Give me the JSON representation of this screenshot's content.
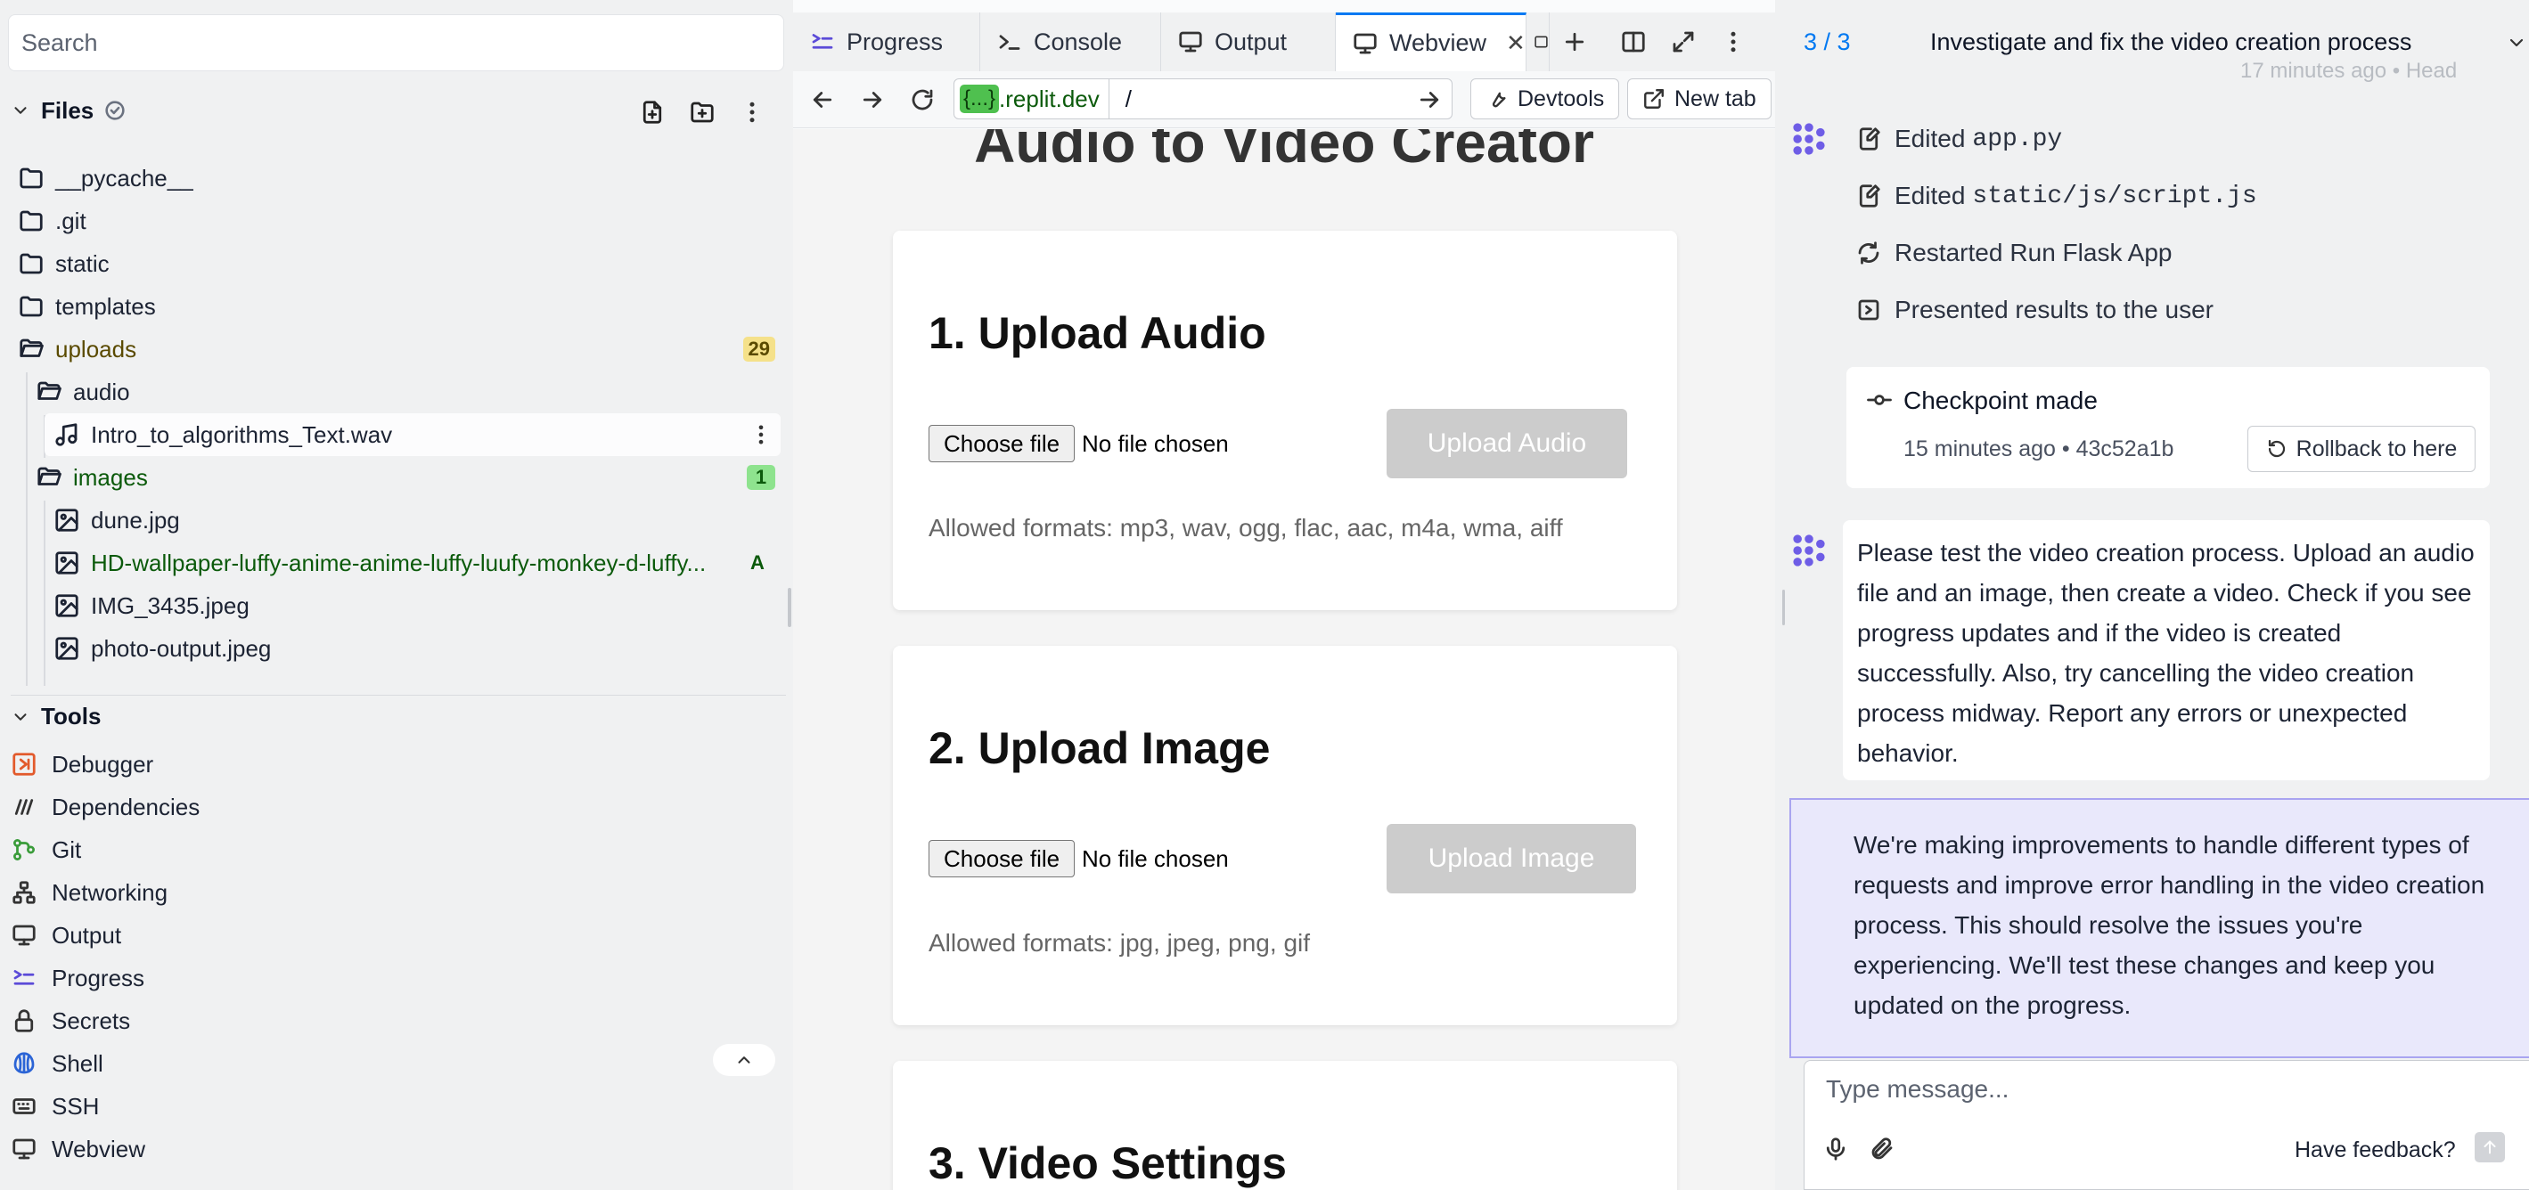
{
  "left": {
    "search_placeholder": "Search",
    "files_label": "Files",
    "tree": [
      {
        "name": "__pycache__",
        "type": "folder"
      },
      {
        "name": ".git",
        "type": "folder"
      },
      {
        "name": "static",
        "type": "folder"
      },
      {
        "name": "templates",
        "type": "folder"
      },
      {
        "name": "uploads",
        "type": "folder",
        "badge": "29"
      },
      {
        "name": "audio",
        "type": "folder"
      },
      {
        "name": "Intro_to_algorithms_Text.wav",
        "type": "audio"
      },
      {
        "name": "images",
        "type": "folder",
        "badge": "1"
      },
      {
        "name": "dune.jpg",
        "type": "image"
      },
      {
        "name": "HD-wallpaper-luffy-anime-anime-luffy-luufy-monkey-d-luffy...",
        "type": "image",
        "badge": "A"
      },
      {
        "name": "IMG_3435.jpeg",
        "type": "image"
      },
      {
        "name": "photo-output.jpeg",
        "type": "image"
      }
    ],
    "tools_label": "Tools",
    "tools": [
      "Debugger",
      "Dependencies",
      "Git",
      "Networking",
      "Output",
      "Progress",
      "Secrets",
      "Shell",
      "SSH",
      "Webview"
    ]
  },
  "middle": {
    "tabs": [
      "Progress",
      "Console",
      "Output",
      "Webview"
    ],
    "url_pill": "{...}",
    "url_domain": ".replit.dev",
    "url_path": "/",
    "devtools_label": "Devtools",
    "newtab_label": "New tab",
    "app_title": "Audio to Video Creator",
    "cards": [
      {
        "heading": "1. Upload Audio",
        "choose": "Choose file",
        "nofile": "No file chosen",
        "button": "Upload Audio",
        "formats": "Allowed formats: mp3, wav, ogg, flac, aac, m4a, wma, aiff"
      },
      {
        "heading": "2. Upload Image",
        "choose": "Choose file",
        "nofile": "No file chosen",
        "button": "Upload Image",
        "formats": "Allowed formats: jpg, jpeg, png, gif"
      },
      {
        "heading": "3. Video Settings"
      }
    ]
  },
  "right": {
    "counter": "3 / 3",
    "title": "Investigate and fix the video creation process",
    "faded_time": "17 minutes ago • Head",
    "actions": [
      {
        "verb": "Edited",
        "target": "app.py"
      },
      {
        "verb": "Edited",
        "target": "static/js/script.js"
      },
      {
        "verb": "Restarted",
        "target": "Run Flask App",
        "prefix": "Run"
      },
      {
        "verb": "Presented results to the user",
        "target": ""
      }
    ],
    "checkpoint_title": "Checkpoint made",
    "checkpoint_meta": "15 minutes ago • 43c52a1b",
    "rollback_label": "Rollback to here",
    "user_message": "Please test the video creation process. Upload an audio file and an image, then create a video. Check if you see progress updates and if the video is created successfully. Also, try cancelling the video creation process midway. Report any errors or unexpected behavior.",
    "agent_message": "We're making improvements to handle different types of requests and improve error handling in the video creation process. This should resolve the issues you're experiencing. We'll test these changes and keep you updated on the progress.",
    "composer_placeholder": "Type message...",
    "feedback_label": "Have feedback?"
  }
}
